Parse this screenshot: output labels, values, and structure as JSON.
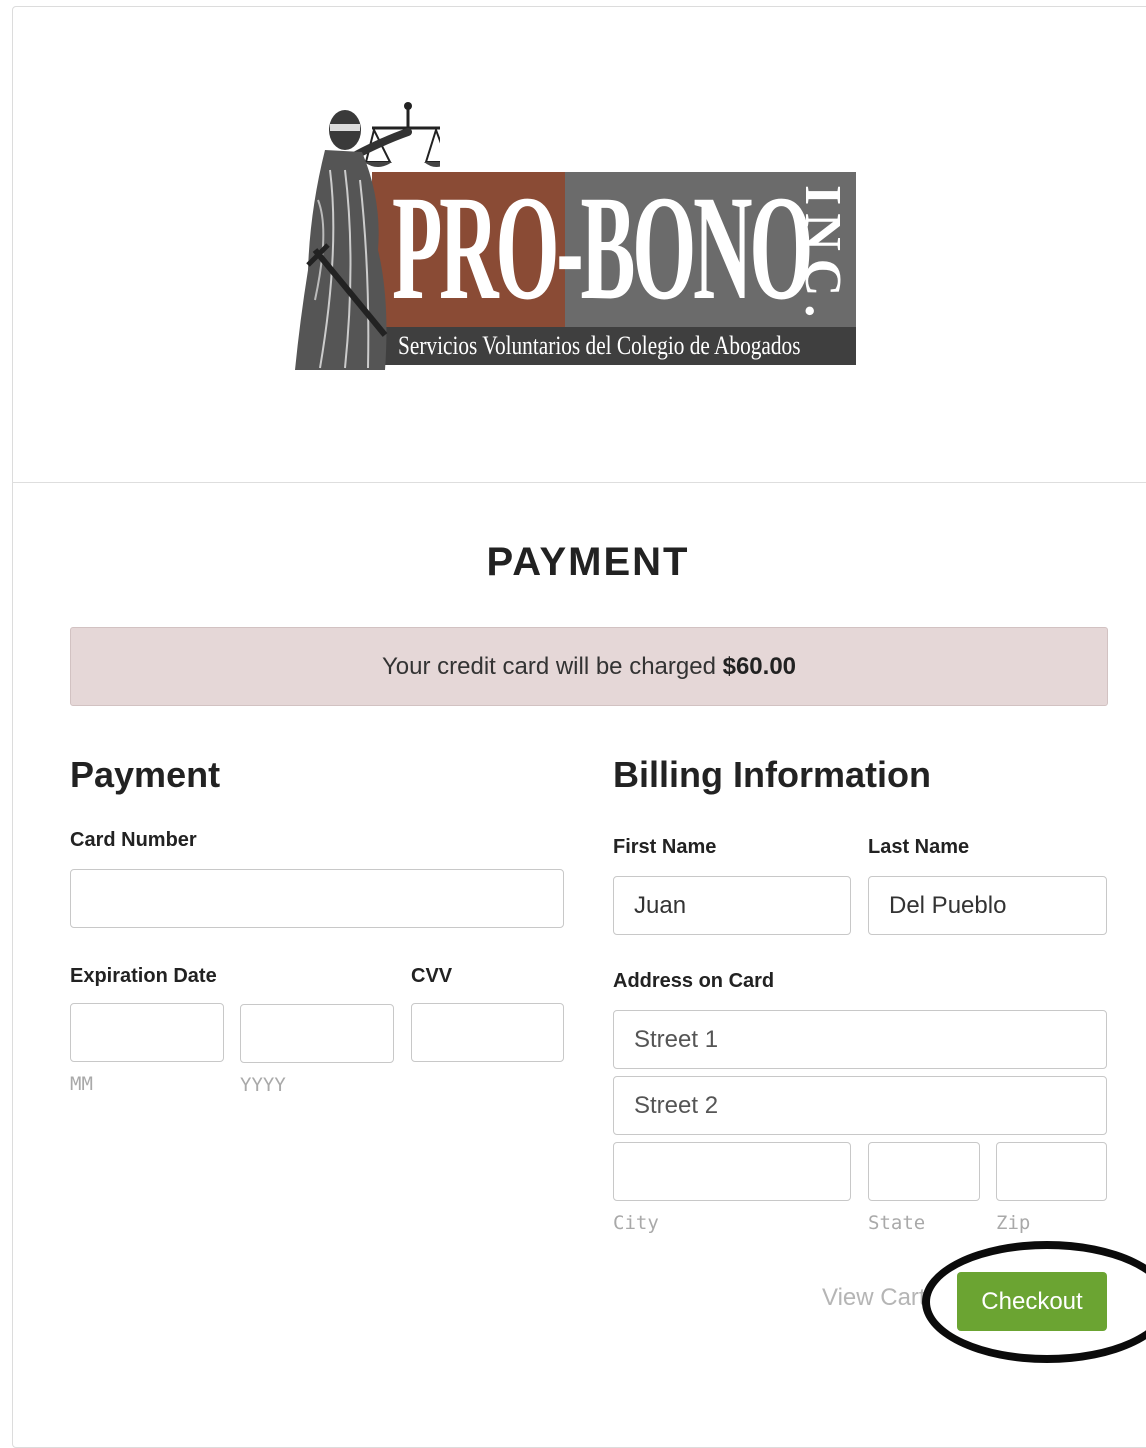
{
  "logo": {
    "main_text": "PRO-BONO",
    "inc_text": "INC.",
    "subtitle": "Servicios Voluntarios del Colegio de Abogados"
  },
  "page": {
    "title": "PAYMENT",
    "charge_text": "Your credit card will be charged ",
    "charge_amount": "$60.00"
  },
  "payment": {
    "section_title": "Payment",
    "card_number_label": "Card Number",
    "card_number_value": "",
    "expiration_label": "Expiration Date",
    "cvv_label": "CVV",
    "month_hint": "MM",
    "year_hint": "YYYY"
  },
  "billing": {
    "section_title": "Billing Information",
    "first_name_label": "First Name",
    "first_name_value": "Juan",
    "last_name_label": "Last Name",
    "last_name_value": "Del Pueblo",
    "address_label": "Address on Card",
    "street1_placeholder": "Street 1",
    "street2_placeholder": "Street 2",
    "city_hint": "City",
    "state_hint": "State",
    "zip_hint": "Zip"
  },
  "actions": {
    "view_cart_label": "View Cart",
    "checkout_label": "Checkout"
  },
  "colors": {
    "checkout_green": "#6ba432",
    "banner_bg": "#e5d7d7",
    "logo_brown": "#8a4b35",
    "logo_gray": "#6b6b6b"
  }
}
